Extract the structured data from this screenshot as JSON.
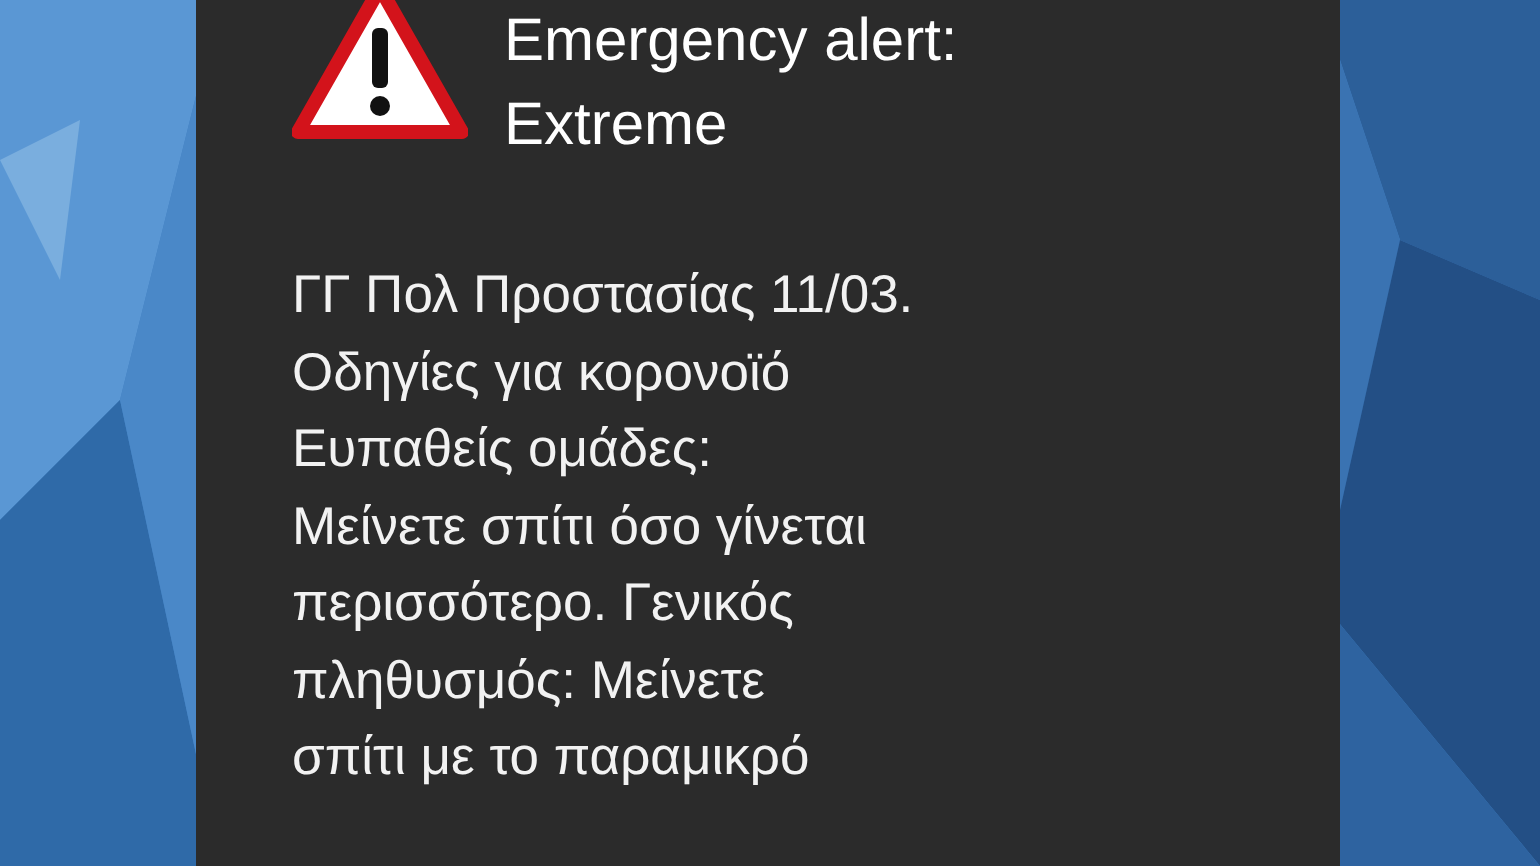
{
  "alert": {
    "title": "Emergency alert: Extreme",
    "message_lines": [
      "ΓΓ Πολ Προστασίας 11/03.",
      "Οδηγίες για κορονοϊό",
      "Ευπαθείς ομάδες:",
      "Μείνετε σπίτι όσο γίνεται",
      "περισσότερο. Γενικός",
      "πληθυσμός: Μείνετε",
      "σπίτι με το παραμικρό"
    ]
  }
}
